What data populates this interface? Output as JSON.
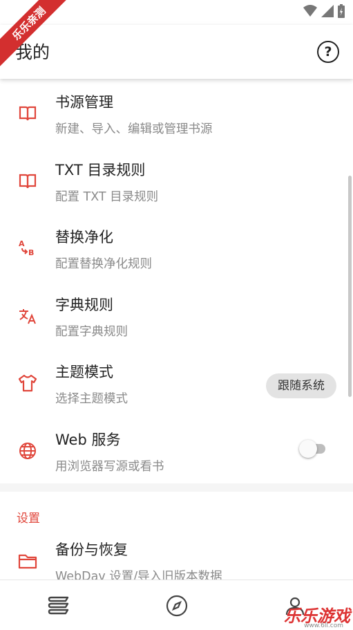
{
  "watermark": {
    "ribbon": "乐乐亲测",
    "brand": "乐乐游戏",
    "url": "www.6ll.com"
  },
  "appbar": {
    "title": "我的",
    "help": "?"
  },
  "rows": [
    {
      "title": "书源管理",
      "subtitle": "新建、导入、编辑或管理书源",
      "icon": "book-icon"
    },
    {
      "title": "TXT 目录规则",
      "subtitle": "配置 TXT 目录规则",
      "icon": "book-icon"
    },
    {
      "title": "替换净化",
      "subtitle": "配置替换净化规则",
      "icon": "find-replace-icon"
    },
    {
      "title": "字典规则",
      "subtitle": "配置字典规则",
      "icon": "translate-icon"
    },
    {
      "title": "主题模式",
      "subtitle": "选择主题模式",
      "icon": "shirt-icon",
      "value": "跟随系统"
    },
    {
      "title": "Web 服务",
      "subtitle": "用浏览器写源或看书",
      "icon": "globe-icon",
      "toggle": false
    }
  ],
  "settings": {
    "header": "设置",
    "rows": [
      {
        "title": "备份与恢复",
        "subtitle": "WebDav 设置/导入旧版本数据",
        "icon": "folder-icon"
      }
    ]
  },
  "colors": {
    "accent": "#e0453a",
    "text": "#222222",
    "secondary": "#8a8a8a"
  },
  "bottom_nav": [
    "bookshelf-icon",
    "compass-icon",
    "person-icon"
  ]
}
